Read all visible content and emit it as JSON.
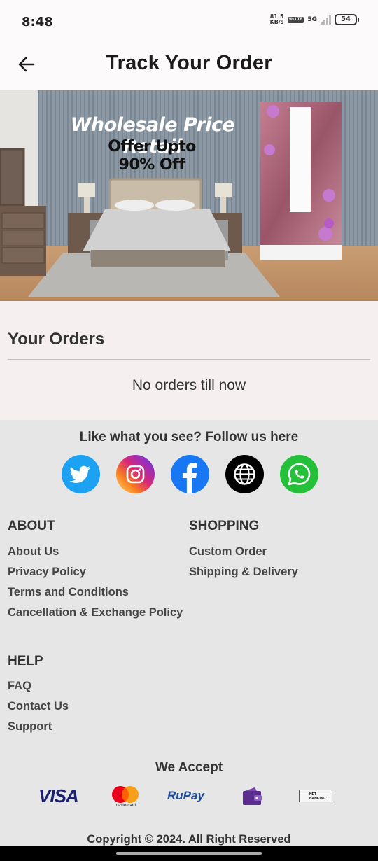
{
  "status": {
    "time": "8:48",
    "speed_value": "81.5",
    "speed_unit": "KB/s",
    "volte": "Vo LTE",
    "network": "5G",
    "battery": "54"
  },
  "header": {
    "title": "Track Your Order"
  },
  "banner": {
    "headline": "Wholesale Price Retail",
    "offer_line1": "Offer Upto",
    "offer_line2": "90% Off"
  },
  "orders": {
    "title": "Your Orders",
    "empty_message": "No orders till now"
  },
  "footer": {
    "follow_text": "Like what you see? Follow us here",
    "socials": [
      "twitter-icon",
      "instagram-icon",
      "facebook-icon",
      "globe-icon",
      "whatsapp-icon"
    ],
    "about": {
      "heading": "ABOUT",
      "links": [
        "About Us",
        "Privacy Policy",
        "Terms and Conditions",
        "Cancellation & Exchange Policy"
      ]
    },
    "shopping": {
      "heading": "SHOPPING",
      "links": [
        "Custom Order",
        "Shipping & Delivery"
      ]
    },
    "help": {
      "heading": "HELP",
      "links": [
        "FAQ",
        "Contact Us",
        "Support"
      ]
    },
    "accept_heading": "We Accept",
    "payments": {
      "visa": "VISA",
      "mastercard": "mastercard",
      "rupay": "RuPay",
      "netbanking_line1": "NET",
      "netbanking_line2": "BANKING"
    },
    "copyright": "Copyright © 2024. All Right Reserved"
  },
  "colors": {
    "twitter": "#1da1f2",
    "facebook": "#1877f2",
    "whatsapp": "#25c03a",
    "visa": "#1a1f71",
    "rupay": "#1b4d9c"
  }
}
